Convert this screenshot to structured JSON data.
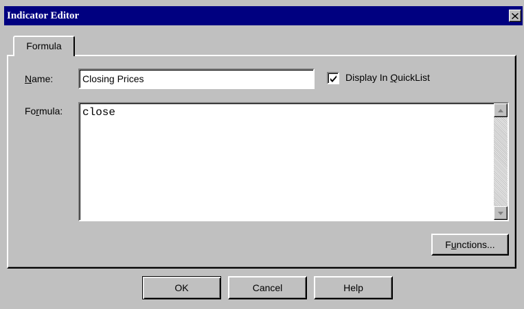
{
  "window": {
    "title": "Indicator Editor",
    "colors": {
      "titlebar": "#000080",
      "face": "#c0c0c0"
    }
  },
  "tabs": [
    {
      "label": "Formula",
      "active": true
    }
  ],
  "form": {
    "name_label_accel": "N",
    "name_label_rest": "ame:",
    "name_value": "Closing Prices",
    "display_checkbox_label_pre": "Display In ",
    "display_checkbox_label_accel": "Q",
    "display_checkbox_label_post": "uickList",
    "display_checked": true,
    "formula_label_pre": "Fo",
    "formula_label_accel": "r",
    "formula_label_post": "mula:",
    "formula_value": "close",
    "functions_pre": "F",
    "functions_accel": "u",
    "functions_post": "nctions..."
  },
  "buttons": {
    "ok": "OK",
    "cancel": "Cancel",
    "help": "Help"
  },
  "icons": {
    "close": "close-icon",
    "check": "checkmark-icon",
    "scroll_up": "scroll-up-arrow-icon",
    "scroll_down": "scroll-down-arrow-icon"
  }
}
